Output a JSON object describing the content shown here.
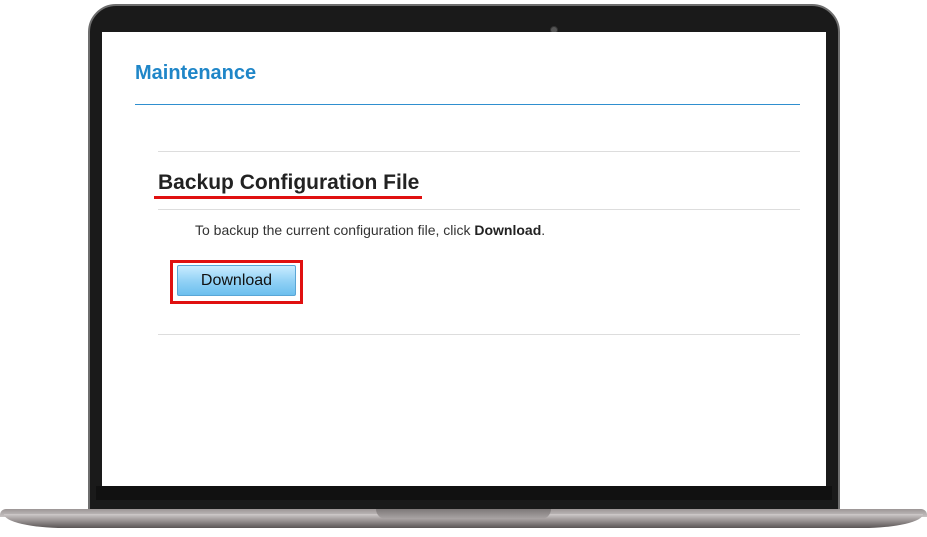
{
  "page": {
    "title": "Maintenance"
  },
  "backup": {
    "heading": "Backup Configuration File",
    "instruction_prefix": "To backup the current configuration file, click ",
    "instruction_bold": "Download",
    "instruction_suffix": ".",
    "download_label": "Download"
  },
  "colors": {
    "title": "#1f86c8",
    "highlight": "#e01010",
    "button": "#8fd0f5"
  }
}
